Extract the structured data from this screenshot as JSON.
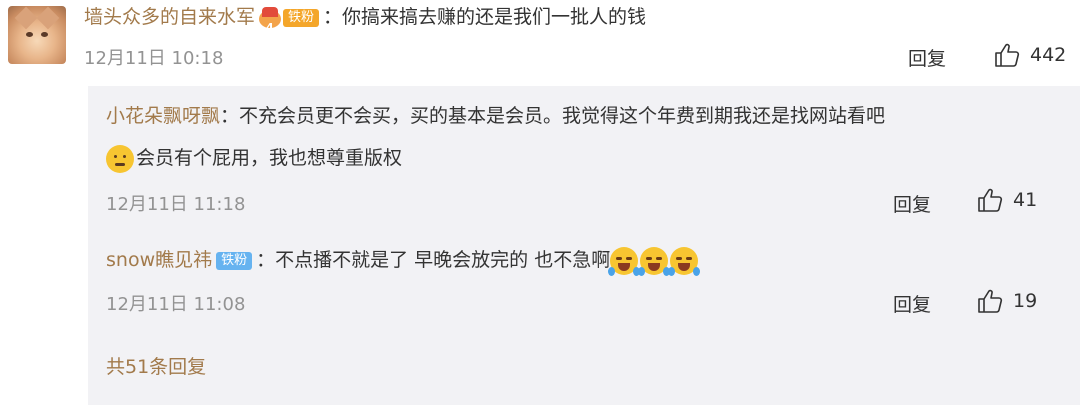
{
  "main_comment": {
    "username": "墙头众多的自来水军",
    "badge": "铁粉",
    "text": "你搞来搞去赚的还是我们一批人的钱",
    "time": "12月11日 10:18",
    "reply_label": "回复",
    "likes": "442"
  },
  "replies": [
    {
      "username": "小花朵飘呀飘",
      "text_line1": "不充会员更不会买，买的基本是会员。我觉得这个年费到期我还是找网站看吧",
      "text_line2": "会员有个屁用，我也想尊重版权",
      "emoji": "shrug-emoji",
      "time": "12月11日 11:18",
      "reply_label": "回复",
      "likes": "41"
    },
    {
      "username": "snow瞧见祎",
      "badge": "铁粉",
      "text": "不点播不就是了 早晚会放完的 也不急啊",
      "emoji": "crying-laughing-emoji",
      "time": "12月11日 11:08",
      "reply_label": "回复",
      "likes": "19"
    }
  ],
  "total_replies_label": "共51条回复",
  "colors": {
    "username": "#a27a4b",
    "time": "#939393",
    "panel_bg": "#f2f2f5",
    "fans_orange": "#f4a62a",
    "fans_blue": "#66b3f0"
  }
}
